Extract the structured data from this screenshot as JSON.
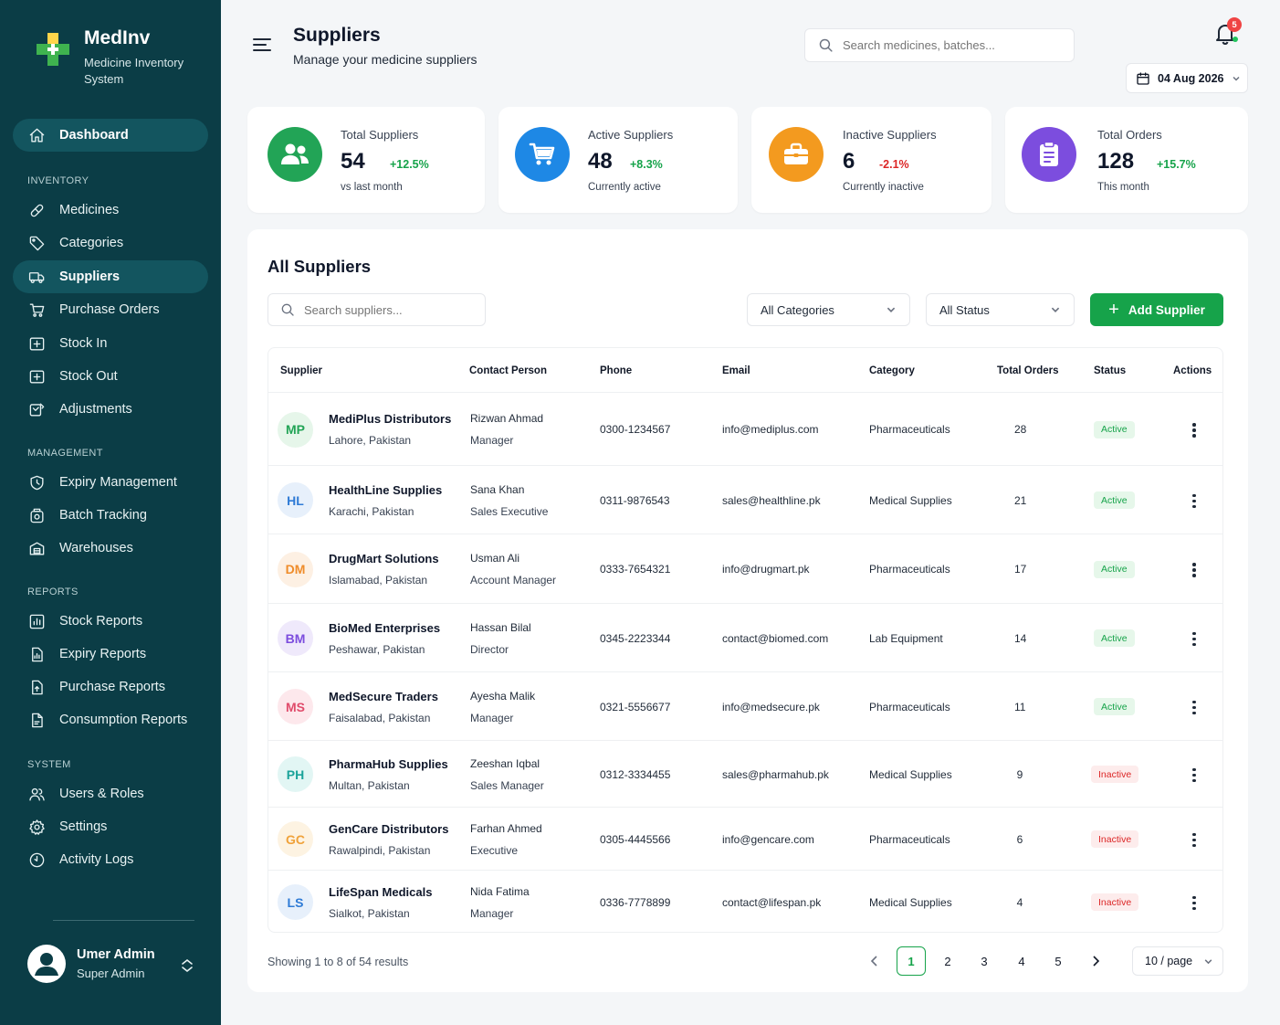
{
  "brand": {
    "title": "MedInv",
    "subtitle": "Medicine Inventory System"
  },
  "sidebar": {
    "dashboard": "Dashboard",
    "sections": {
      "inventory": "INVENTORY",
      "management": "MANAGEMENT",
      "reports": "REPORTS",
      "system": "SYSTEM"
    },
    "items": {
      "medicines": "Medicines",
      "categories": "Categories",
      "suppliers": "Suppliers",
      "purchase_orders": "Purchase Orders",
      "stock_in": "Stock In",
      "stock_out": "Stock Out",
      "adjustments": "Adjustments",
      "expiry_management": "Expiry Management",
      "batch_tracking": "Batch Tracking",
      "warehouses": "Warehouses",
      "stock_reports": "Stock Reports",
      "expiry_reports": "Expiry Reports",
      "purchase_reports": "Purchase Reports",
      "consumption_reports": "Consumption Reports",
      "users_roles": "Users & Roles",
      "settings": "Settings",
      "activity_logs": "Activity Logs"
    },
    "user": {
      "name": "Umer Admin",
      "role": "Super Admin"
    }
  },
  "header": {
    "title": "Suppliers",
    "subtitle": "Manage your medicine suppliers",
    "search_placeholder": "Search medicines, batches...",
    "notification_count": "5",
    "date": "04 Aug 2026"
  },
  "stats": [
    {
      "label": "Total Suppliers",
      "value": "54",
      "change": "+12.5%",
      "note": "vs last month",
      "color": "#22a456"
    },
    {
      "label": "Active Suppliers",
      "value": "48",
      "change": "+8.3%",
      "note": "Currently active",
      "color": "#1e88e5"
    },
    {
      "label": "Inactive Suppliers",
      "value": "6",
      "change": "-2.1%",
      "note": "Currently inactive",
      "color": "#f39a1f"
    },
    {
      "label": "Total Orders",
      "value": "128",
      "change": "+15.7%",
      "note": "This month",
      "color": "#7c4dde"
    }
  ],
  "panel": {
    "title": "All Suppliers",
    "search_placeholder": "Search suppliers...",
    "category_filter": "All Categories",
    "status_filter": "All Status",
    "add_button": "Add Supplier",
    "columns": [
      "Supplier",
      "Contact Person",
      "Phone",
      "Email",
      "Category",
      "Total Orders",
      "Status",
      "Actions"
    ],
    "rows": [
      {
        "initials": "MP",
        "name": "MediPlus Distributors",
        "location": "Lahore, Pakistan",
        "contact": "Rizwan Ahmad",
        "contact_role": "Manager",
        "phone": "0300-1234567",
        "email": "info@mediplus.com",
        "category": "Pharmaceuticals",
        "orders": "28",
        "status": "Active"
      },
      {
        "initials": "HL",
        "name": "HealthLine Supplies",
        "location": "Karachi, Pakistan",
        "contact": "Sana Khan",
        "contact_role": "Sales Executive",
        "phone": "0311-9876543",
        "email": "sales@healthline.pk",
        "category": "Medical Supplies",
        "orders": "21",
        "status": "Active"
      },
      {
        "initials": "DM",
        "name": "DrugMart Solutions",
        "location": "Islamabad, Pakistan",
        "contact": "Usman Ali",
        "contact_role": "Account Manager",
        "phone": "0333-7654321",
        "email": "info@drugmart.pk",
        "category": "Pharmaceuticals",
        "orders": "17",
        "status": "Active"
      },
      {
        "initials": "BM",
        "name": "BioMed Enterprises",
        "location": "Peshawar, Pakistan",
        "contact": "Hassan Bilal",
        "contact_role": "Director",
        "phone": "0345-2223344",
        "email": "contact@biomed.com",
        "category": "Lab Equipment",
        "orders": "14",
        "status": "Active"
      },
      {
        "initials": "MS",
        "name": "MedSecure Traders",
        "location": "Faisalabad, Pakistan",
        "contact": "Ayesha Malik",
        "contact_role": "Manager",
        "phone": "0321-5556677",
        "email": "info@medsecure.pk",
        "category": "Pharmaceuticals",
        "orders": "11",
        "status": "Active"
      },
      {
        "initials": "PH",
        "name": "PharmaHub Supplies",
        "location": "Multan, Pakistan",
        "contact": "Zeeshan Iqbal",
        "contact_role": "Sales Manager",
        "phone": "0312-3334455",
        "email": "sales@pharmahub.pk",
        "category": "Medical Supplies",
        "orders": "9",
        "status": "Inactive"
      },
      {
        "initials": "GC",
        "name": "GenCare Distributors",
        "location": "Rawalpindi, Pakistan",
        "contact": "Farhan Ahmed",
        "contact_role": "Executive",
        "phone": "0305-4445566",
        "email": "info@gencare.com",
        "category": "Pharmaceuticals",
        "orders": "6",
        "status": "Inactive"
      },
      {
        "initials": "LS",
        "name": "LifeSpan Medicals",
        "location": "Sialkot, Pakistan",
        "contact": "Nida Fatima",
        "contact_role": "Manager",
        "phone": "0336-7778899",
        "email": "contact@lifespan.pk",
        "category": "Medical Supplies",
        "orders": "4",
        "status": "Inactive"
      }
    ],
    "showing": "Showing 1 to 8 of 54 results",
    "pages": [
      "1",
      "2",
      "3",
      "4",
      "5"
    ],
    "per_page": "10 / page"
  },
  "colors": {
    "sidebar": "#0b3d46",
    "accent": "#16a34a",
    "active": "#16a34a",
    "inactive": "#dc2626"
  }
}
